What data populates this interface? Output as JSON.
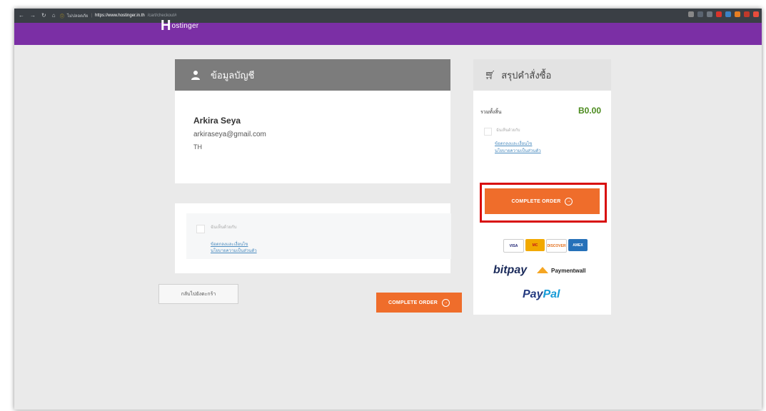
{
  "browser": {
    "security_label": "ไม่ปลอดภัย",
    "url_host": "https://www.hostinger.in.th",
    "url_path": "/cart/checkout#"
  },
  "brand": {
    "logo_initial": "H",
    "logo_word": "ostinger"
  },
  "account": {
    "title": "ข้อมูลบัญชี",
    "name": "Arkira Seya",
    "email": "arkiraseya@gmail.com",
    "country": "TH"
  },
  "terms": {
    "agree_label": "ฉันเห็นด้วยกับ",
    "terms_link": "ข้อตกลงและเงื่อนไข",
    "privacy_link": "นโยบายความเป็นส่วนตัว"
  },
  "actions": {
    "back_label": "กลับไปยังตะกร้า",
    "complete_order": "COMPLETE ORDER"
  },
  "summary": {
    "title": "สรุปคำสั่งซื้อ",
    "total_label": "รวมทั้งสิ้น",
    "total_value": "B0.00",
    "agree_label": "ฉันเห็นด้วยกับ",
    "terms_link": "ข้อตกลงและเงื่อนไข",
    "privacy_link": "นโยบายความเป็นส่วนตัว"
  },
  "payments": {
    "cards": [
      "VISA",
      "MC",
      "DISCOVER",
      "AMEX"
    ],
    "bitpay": "bitpay",
    "paymentwall": "Paymentwall",
    "paypal_a": "Pay",
    "paypal_b": "Pal"
  },
  "colors": {
    "brand_purple": "#7b2fa5",
    "order_orange": "#ef6d2b",
    "total_green": "#4a8a1c",
    "highlight_red": "#d80d0d"
  }
}
